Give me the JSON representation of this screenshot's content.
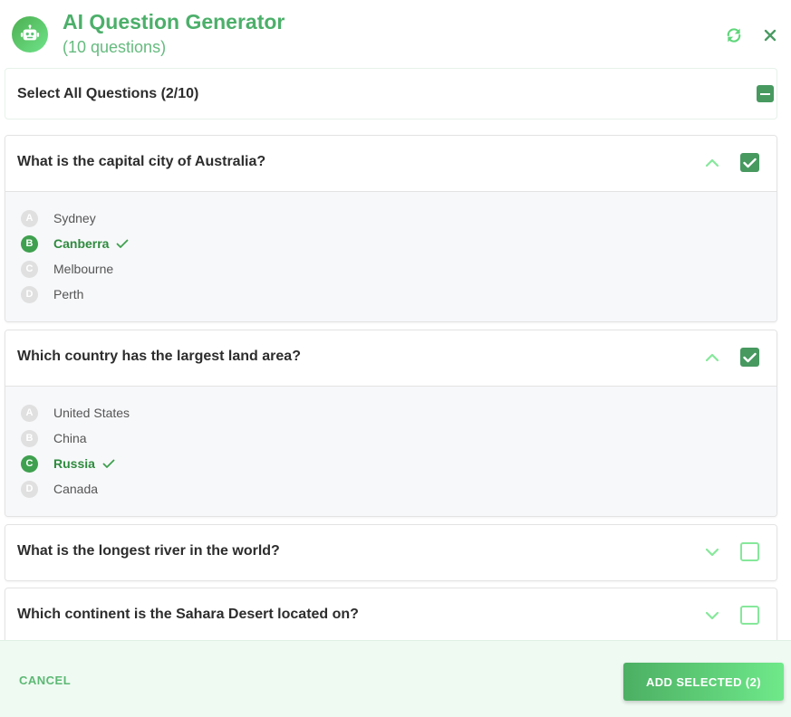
{
  "header": {
    "title": "AI Question Generator",
    "subtitle": "(10 questions)",
    "logo_icon": "robot-icon",
    "refresh_icon": "refresh-icon",
    "close_icon": "close-icon"
  },
  "select_all": {
    "label": "Select All Questions (2/10)",
    "state": "indeterminate"
  },
  "questions": [
    {
      "text": "What is the capital city of Australia?",
      "expanded": true,
      "selected": true,
      "options": [
        {
          "letter": "A",
          "text": "Sydney",
          "correct": false
        },
        {
          "letter": "B",
          "text": "Canberra",
          "correct": true
        },
        {
          "letter": "C",
          "text": "Melbourne",
          "correct": false
        },
        {
          "letter": "D",
          "text": "Perth",
          "correct": false
        }
      ]
    },
    {
      "text": "Which country has the largest land area?",
      "expanded": true,
      "selected": true,
      "options": [
        {
          "letter": "A",
          "text": "United States",
          "correct": false
        },
        {
          "letter": "B",
          "text": "China",
          "correct": false
        },
        {
          "letter": "C",
          "text": "Russia",
          "correct": true
        },
        {
          "letter": "D",
          "text": "Canada",
          "correct": false
        }
      ]
    },
    {
      "text": "What is the longest river in the world?",
      "expanded": false,
      "selected": false
    },
    {
      "text": "Which continent is the Sahara Desert located on?",
      "expanded": false,
      "selected": false
    }
  ],
  "footer": {
    "cancel_label": "CANCEL",
    "add_label": "ADD SELECTED (2)"
  },
  "colors": {
    "accent": "#4caf6a",
    "checkbox_checked": "#479960",
    "checkbox_unchecked_border": "#86e89b",
    "correct": "#3fa04f",
    "footer_bg": "#effaf2"
  }
}
